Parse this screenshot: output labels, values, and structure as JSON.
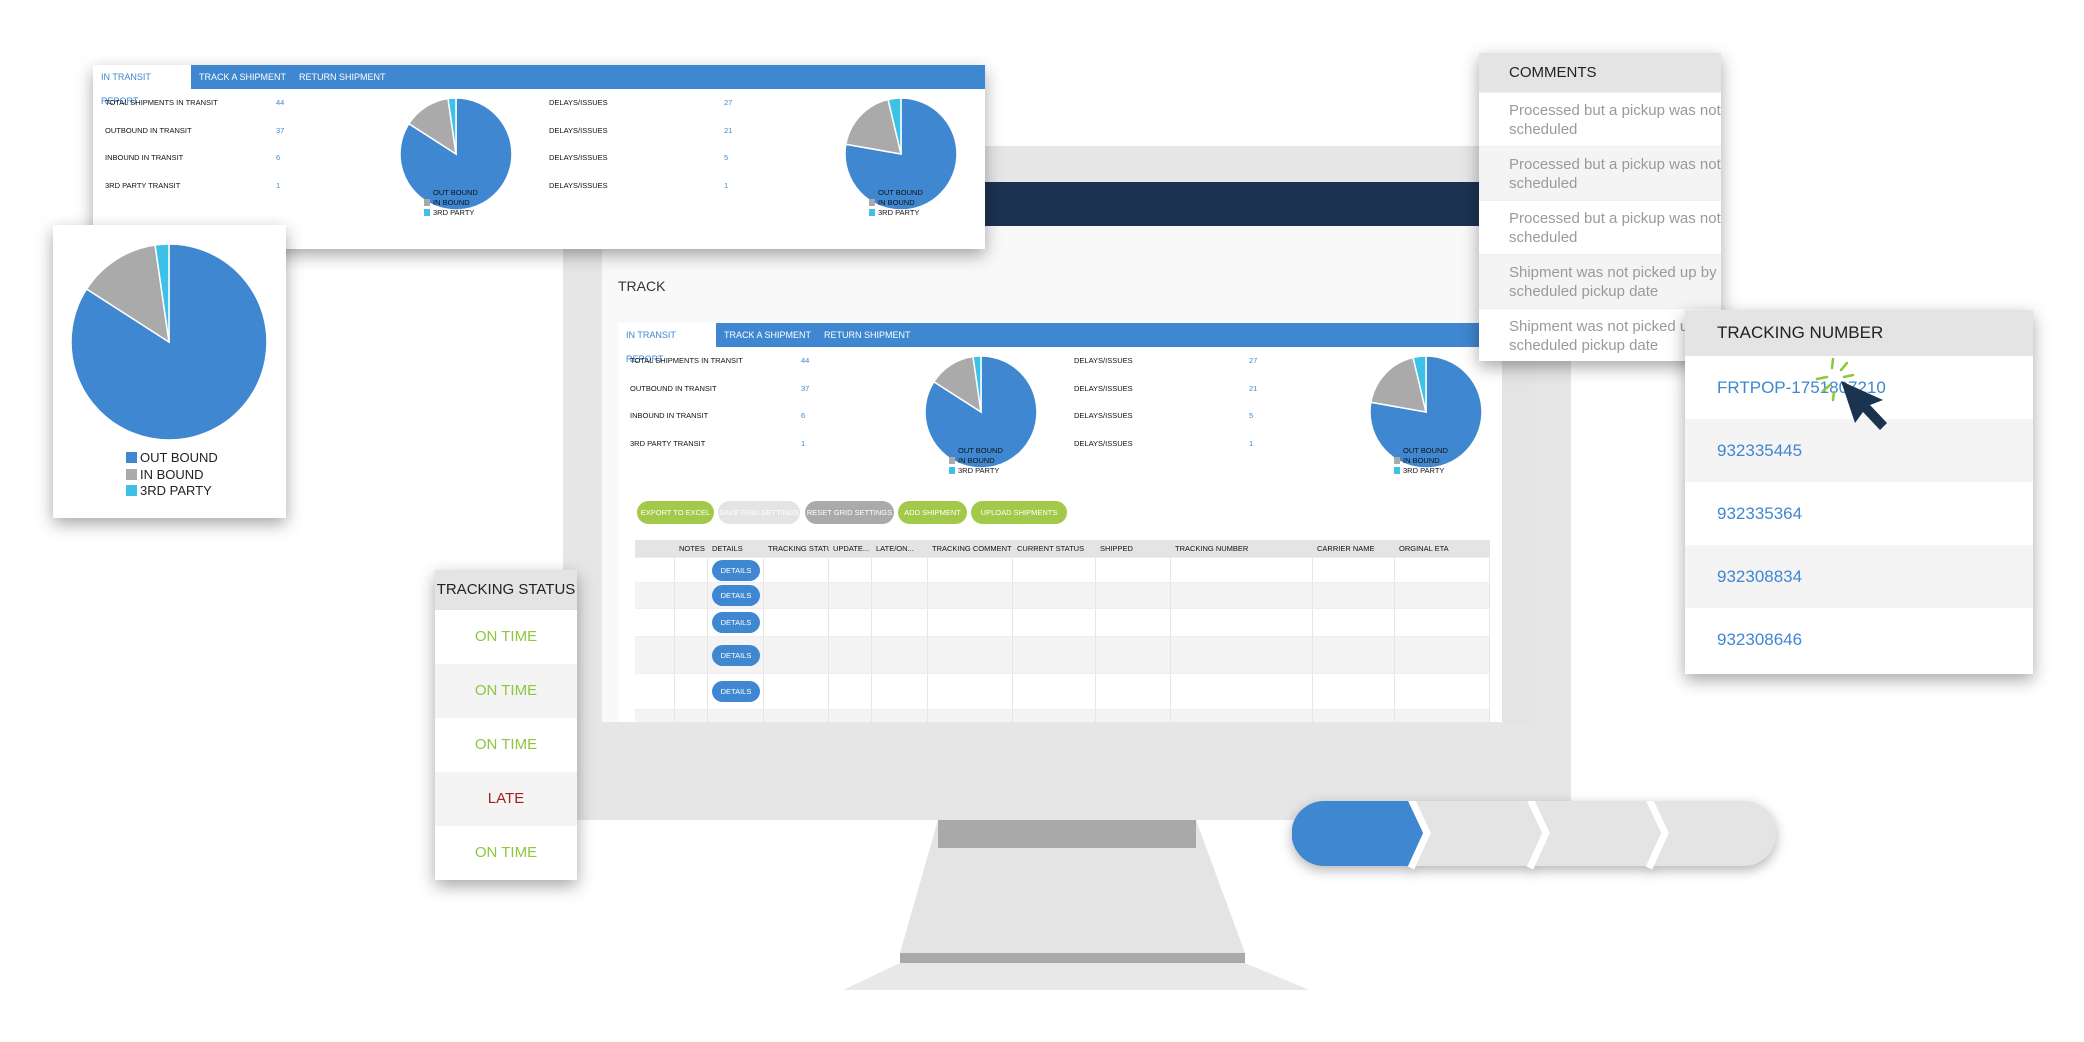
{
  "report": {
    "tabs": [
      "IN TRANSIT REPORT",
      "TRACK A SHIPMENT",
      "RETURN SHIPMENT"
    ],
    "left_stats": [
      {
        "label": "TOTAL SHIPMENTS IN TRANSIT",
        "value": "44"
      },
      {
        "label": "OUTBOUND IN TRANSIT",
        "value": "37"
      },
      {
        "label": "INBOUND IN TRANSIT",
        "value": "6"
      },
      {
        "label": "3RD PARTY TRANSIT",
        "value": "1"
      }
    ],
    "right_stats": [
      {
        "label": "DELAYS/ISSUES",
        "value": "27"
      },
      {
        "label": "DELAYS/ISSUES",
        "value": "21"
      },
      {
        "label": "DELAYS/ISSUES",
        "value": "5"
      },
      {
        "label": "DELAYS/ISSUES",
        "value": "1"
      }
    ],
    "legend": [
      "OUT BOUND",
      "IN BOUND",
      "3RD PARTY"
    ],
    "colors": [
      "#3f87d0",
      "#aaaaaa",
      "#3ec1e6"
    ],
    "pie_transit": [
      37,
      6,
      1
    ],
    "pie_delays": [
      21,
      5,
      1
    ]
  },
  "page": {
    "title": "TRACK"
  },
  "buttons": [
    {
      "label": "EXPORT TO EXCEL",
      "color": "#a3c94b"
    },
    {
      "label": "SAVE GRID SETTINGS",
      "color": "#e4e4e4"
    },
    {
      "label": "RESET GRID SETTINGS",
      "color": "#aaaaaa"
    },
    {
      "label": "ADD SHIPMENT",
      "color": "#a3c94b"
    },
    {
      "label": "UPLOAD SHIPMENTS",
      "color": "#a3c94b"
    }
  ],
  "grid": {
    "columns": [
      "",
      "NOTES",
      "DETAILS",
      "TRACKING STATUS",
      "UPDATE...",
      "LATE/ON...",
      "TRACKING COMMENT",
      "CURRENT STATUS",
      "SHIPPED",
      "TRACKING NUMBER",
      "CARRIER NAME",
      "ORGINAL ETA"
    ],
    "details_label": "DETAILS",
    "row_count": 5
  },
  "tracking_status": {
    "header": "TRACKING STATUS",
    "rows": [
      {
        "text": "ON TIME",
        "color": "#8dc63f"
      },
      {
        "text": "ON TIME",
        "color": "#8dc63f"
      },
      {
        "text": "ON TIME",
        "color": "#8dc63f"
      },
      {
        "text": "LATE",
        "color": "#a4201c"
      },
      {
        "text": "ON TIME",
        "color": "#8dc63f"
      }
    ]
  },
  "comments": {
    "header": "COMMENTS",
    "rows": [
      "Processed but a pickup was not scheduled",
      "Processed but a pickup was not scheduled",
      "Processed but a pickup was not scheduled",
      "Shipment was not picked up by scheduled pickup date",
      "Shipment was not picked up by scheduled pickup date"
    ]
  },
  "tracking_numbers": {
    "header": "TRACKING NUMBER",
    "rows": [
      "FRTPOP-1751807210",
      "932335445",
      "932335364",
      "932308834",
      "932308646"
    ]
  },
  "progress": {
    "steps": 4,
    "completed": 1,
    "active_color": "#3f87d0"
  },
  "cursor": {
    "icon": "mouse-pointer-icon",
    "color": "#1a334f"
  }
}
